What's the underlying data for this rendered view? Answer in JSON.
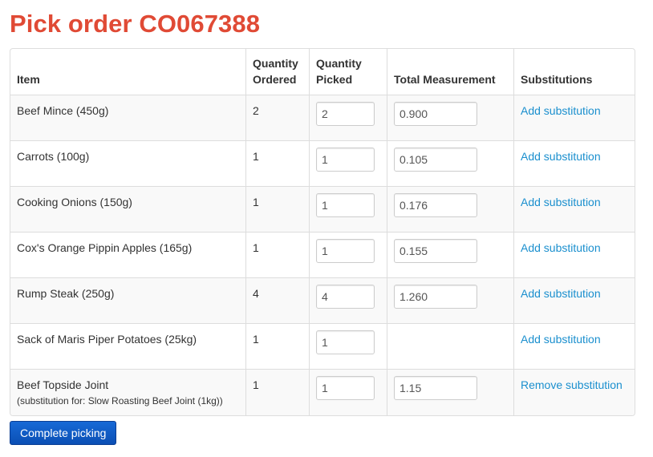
{
  "page": {
    "title": "Pick order CO067388"
  },
  "table": {
    "headers": {
      "item": "Item",
      "quantity_ordered": "Quantity Ordered",
      "quantity_picked": "Quantity Picked",
      "total_measurement": "Total Measurement",
      "substitutions": "Substitutions"
    },
    "rows": [
      {
        "item": "Beef Mince (450g)",
        "note": null,
        "quantity_ordered": "2",
        "quantity_picked": "2",
        "total_measurement": "0.900",
        "action": "Add substitution"
      },
      {
        "item": "Carrots (100g)",
        "note": null,
        "quantity_ordered": "1",
        "quantity_picked": "1",
        "total_measurement": "0.105",
        "action": "Add substitution"
      },
      {
        "item": "Cooking Onions (150g)",
        "note": null,
        "quantity_ordered": "1",
        "quantity_picked": "1",
        "total_measurement": "0.176",
        "action": "Add substitution"
      },
      {
        "item": "Cox's Orange Pippin Apples (165g)",
        "note": null,
        "quantity_ordered": "1",
        "quantity_picked": "1",
        "total_measurement": "0.155",
        "action": "Add substitution"
      },
      {
        "item": "Rump Steak (250g)",
        "note": null,
        "quantity_ordered": "4",
        "quantity_picked": "4",
        "total_measurement": "1.260",
        "action": "Add substitution"
      },
      {
        "item": "Sack of Maris Piper Potatoes (25kg)",
        "note": null,
        "quantity_ordered": "1",
        "quantity_picked": "1",
        "total_measurement": null,
        "action": "Add substitution"
      },
      {
        "item": "Beef Topside Joint",
        "note": "(substitution for: Slow Roasting Beef Joint (1kg))",
        "quantity_ordered": "1",
        "quantity_picked": "1",
        "total_measurement": "1.15",
        "action": "Remove substitution"
      }
    ]
  },
  "actions": {
    "complete_label": "Complete picking"
  },
  "colors": {
    "title": "#e04a35",
    "link": "#1a8fce",
    "button": "#0b4fb4"
  }
}
